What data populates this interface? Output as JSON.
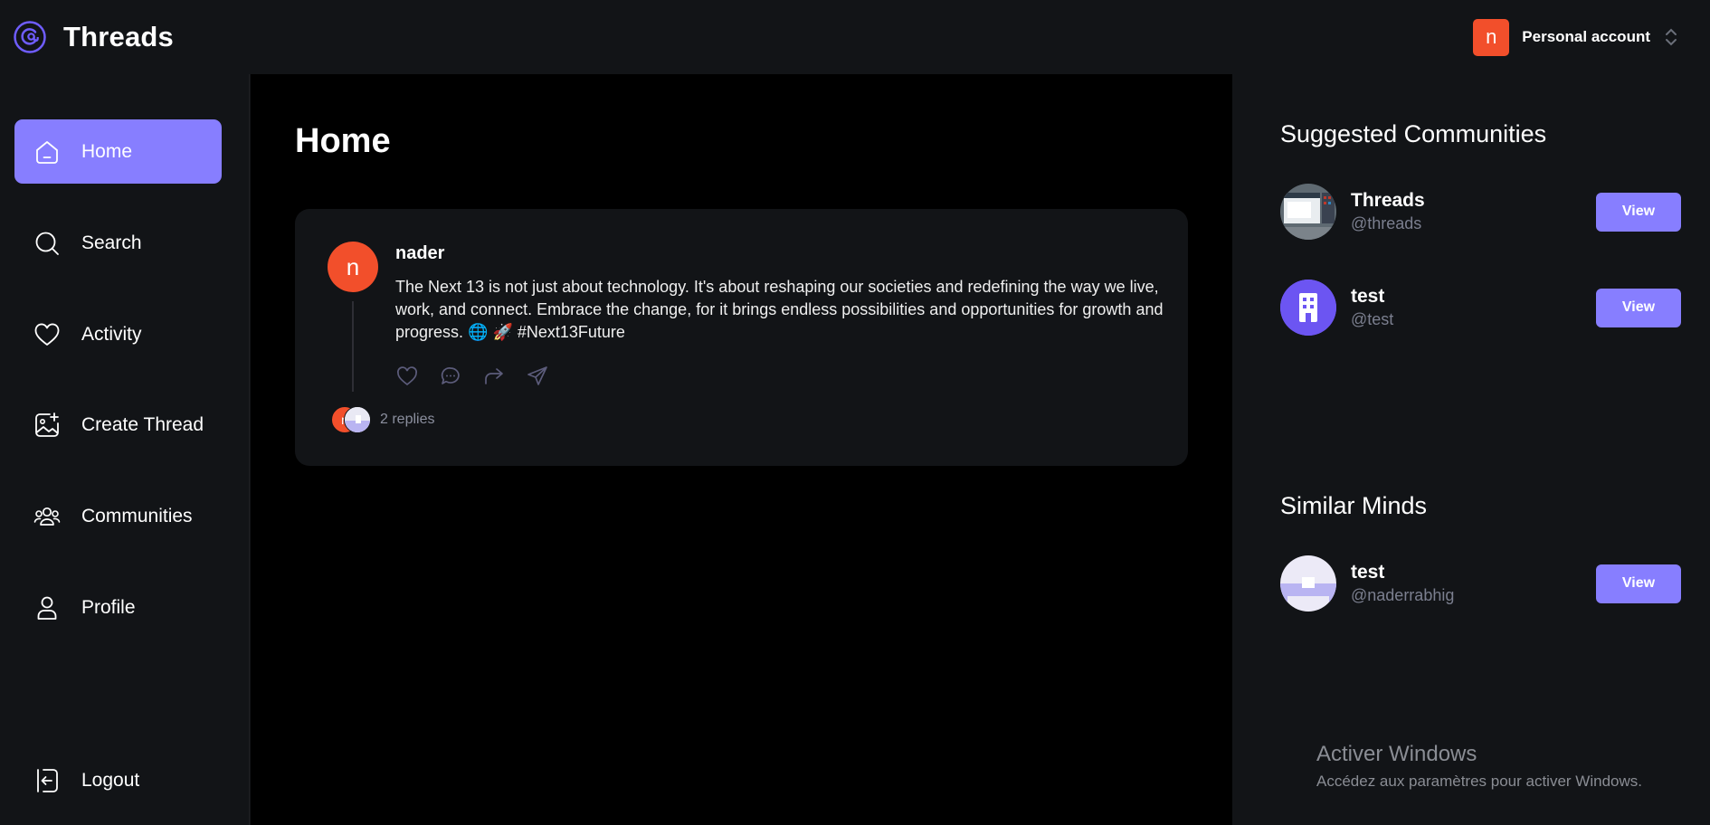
{
  "app": {
    "name": "Threads",
    "logo_icon": "threads-logo-icon"
  },
  "account": {
    "initial": "n",
    "label": "Personal account",
    "avatar_color": "#f24f2b"
  },
  "sidebar": {
    "items": [
      {
        "label": "Home",
        "icon": "home-icon",
        "active": true
      },
      {
        "label": "Search",
        "icon": "search-icon"
      },
      {
        "label": "Activity",
        "icon": "heart-icon"
      },
      {
        "label": "Create Thread",
        "icon": "create-image-icon"
      },
      {
        "label": "Communities",
        "icon": "users-icon"
      },
      {
        "label": "Profile",
        "icon": "user-icon"
      }
    ],
    "logout": {
      "label": "Logout",
      "icon": "logout-icon"
    }
  },
  "main": {
    "title": "Home",
    "threads": [
      {
        "author_initial": "n",
        "author": "nader",
        "content": "The Next 13 is not just about technology. It's about reshaping our societies and redefining the way we live, work, and connect. Embrace the change, for it brings endless possibilities and opportunities for growth and progress. 🌐 🚀 #Next13Future",
        "reply_avatar_initial": "n",
        "replies": "2 replies"
      }
    ]
  },
  "right": {
    "communities_title": "Suggested Communities",
    "communities": [
      {
        "name": "Threads",
        "handle": "@threads",
        "action": "View"
      },
      {
        "name": "test",
        "handle": "@test",
        "action": "View"
      }
    ],
    "similar_title": "Similar Minds",
    "users": [
      {
        "name": "test",
        "handle": "@naderrabhig",
        "action": "View"
      }
    ]
  },
  "watermark": {
    "title": "Activer Windows",
    "subtitle": "Accédez aux paramètres pour activer Windows."
  },
  "colors": {
    "accent": "#877eff",
    "orange": "#f24f2b",
    "surface": "#121417",
    "background": "#000000"
  }
}
